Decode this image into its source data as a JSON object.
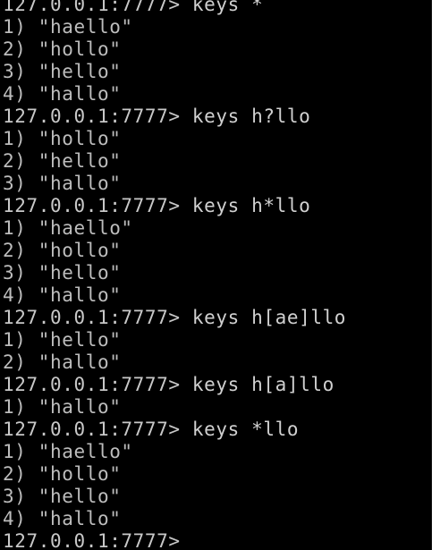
{
  "terminal": {
    "prompt": "127.0.0.1:7777> ",
    "lines": [
      {
        "type": "prompt",
        "cmd": "keys *"
      },
      {
        "type": "output",
        "text": "1) \"haello\""
      },
      {
        "type": "output",
        "text": "2) \"hollo\""
      },
      {
        "type": "output",
        "text": "3) \"hello\""
      },
      {
        "type": "output",
        "text": "4) \"hallo\""
      },
      {
        "type": "prompt",
        "cmd": "keys h?llo"
      },
      {
        "type": "output",
        "text": "1) \"hollo\""
      },
      {
        "type": "output",
        "text": "2) \"hello\""
      },
      {
        "type": "output",
        "text": "3) \"hallo\""
      },
      {
        "type": "prompt",
        "cmd": "keys h*llo"
      },
      {
        "type": "output",
        "text": "1) \"haello\""
      },
      {
        "type": "output",
        "text": "2) \"hollo\""
      },
      {
        "type": "output",
        "text": "3) \"hello\""
      },
      {
        "type": "output",
        "text": "4) \"hallo\""
      },
      {
        "type": "prompt",
        "cmd": "keys h[ae]llo"
      },
      {
        "type": "output",
        "text": "1) \"hello\""
      },
      {
        "type": "output",
        "text": "2) \"hallo\""
      },
      {
        "type": "prompt",
        "cmd": "keys h[a]llo"
      },
      {
        "type": "output",
        "text": "1) \"hallo\""
      },
      {
        "type": "prompt",
        "cmd": "keys *llo"
      },
      {
        "type": "output",
        "text": "1) \"haello\""
      },
      {
        "type": "output",
        "text": "2) \"hollo\""
      },
      {
        "type": "output",
        "text": "3) \"hello\""
      },
      {
        "type": "output",
        "text": "4) \"hallo\""
      },
      {
        "type": "prompt",
        "cmd": ""
      }
    ]
  }
}
